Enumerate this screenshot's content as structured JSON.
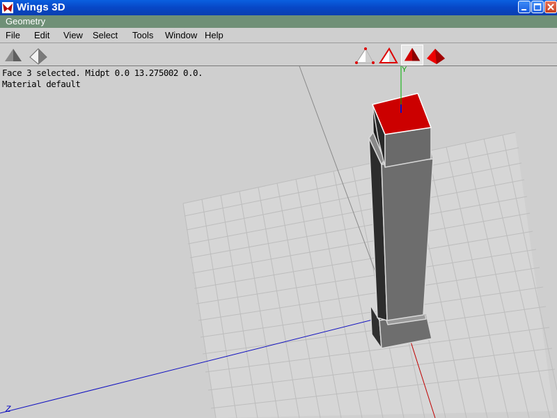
{
  "window": {
    "title": "Wings 3D",
    "subwindow_title": "Geometry"
  },
  "menu": [
    "File",
    "Edit",
    "View",
    "Select",
    "Tools",
    "Window",
    "Help"
  ],
  "toolbar": {
    "left_icons": [
      "smooth-shading-icon",
      "wireframe-shading-icon"
    ],
    "mode_icons": [
      "vertex-mode-icon",
      "edge-mode-icon",
      "face-mode-icon",
      "body-mode-icon"
    ],
    "active_mode": "face"
  },
  "status": {
    "line1": "Face 3 selected. Midpt 0.0 13.275002 0.0.",
    "line2": "Material default"
  },
  "axes": {
    "y_label": "Y",
    "z_label": "Z"
  },
  "colors": {
    "selection": "#cc0000",
    "titlebar": "#0a52d9",
    "geometry_bar": "#6f9077"
  }
}
